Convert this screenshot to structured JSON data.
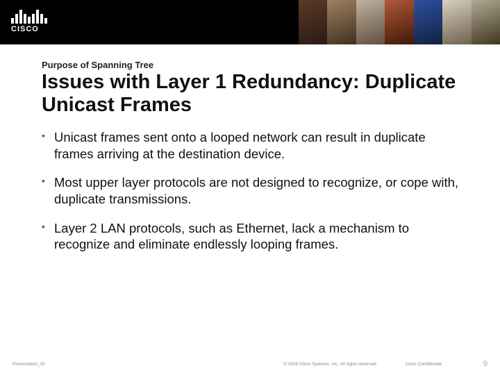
{
  "header": {
    "logo_text": "CISCO"
  },
  "slide": {
    "kicker": "Purpose of Spanning Tree",
    "title": "Issues with Layer 1 Redundancy: Duplicate Unicast Frames",
    "bullets": [
      "Unicast frames sent onto a looped network can result in duplicate frames arriving at the destination device.",
      "Most upper layer protocols are not designed to recognize, or cope with, duplicate transmissions.",
      "Layer 2 LAN protocols, such as Ethernet, lack a mechanism to recognize and eliminate endlessly looping frames."
    ]
  },
  "footer": {
    "presentation_id": "Presentation_ID",
    "copyright": "© 2008 Cisco Systems, Inc. All rights reserved.",
    "confidential": "Cisco Confidential",
    "page_number": "9"
  }
}
